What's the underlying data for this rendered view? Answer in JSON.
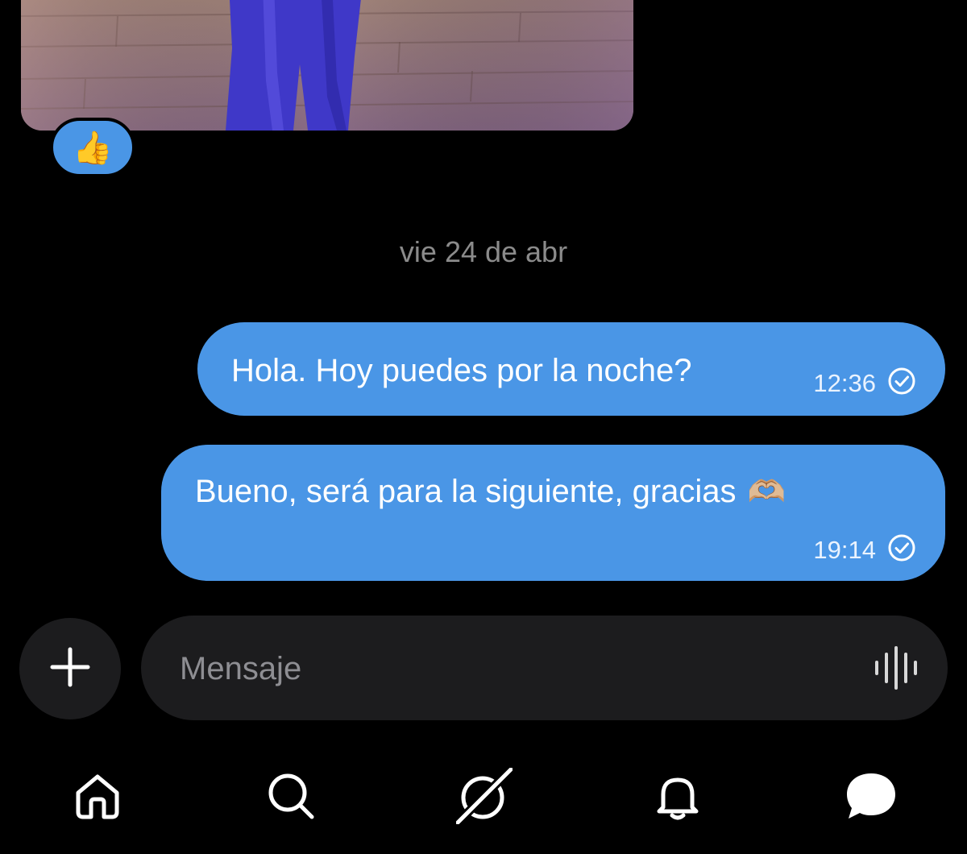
{
  "conversation": {
    "reaction_emoji": "👍",
    "date_separator": "vie 24 de abr",
    "messages": [
      {
        "text": "Hola. Hoy puedes por la noche?",
        "time": "12:36",
        "status": "read-check"
      },
      {
        "text": "Bueno, será para la siguiente, gracias",
        "emoji": "🫶🏼",
        "time": "19:14",
        "status": "read-check"
      }
    ]
  },
  "composer": {
    "placeholder": "Mensaje"
  },
  "nav": {
    "items": [
      {
        "icon": "home-icon"
      },
      {
        "icon": "search-icon"
      },
      {
        "icon": "grok-icon"
      },
      {
        "icon": "bell-icon"
      },
      {
        "icon": "messages-icon",
        "active": true
      }
    ]
  },
  "colors": {
    "bubble": "#4a96e6",
    "background": "#000000",
    "composer": "#1c1c1e",
    "muted": "#8b8b8b"
  }
}
